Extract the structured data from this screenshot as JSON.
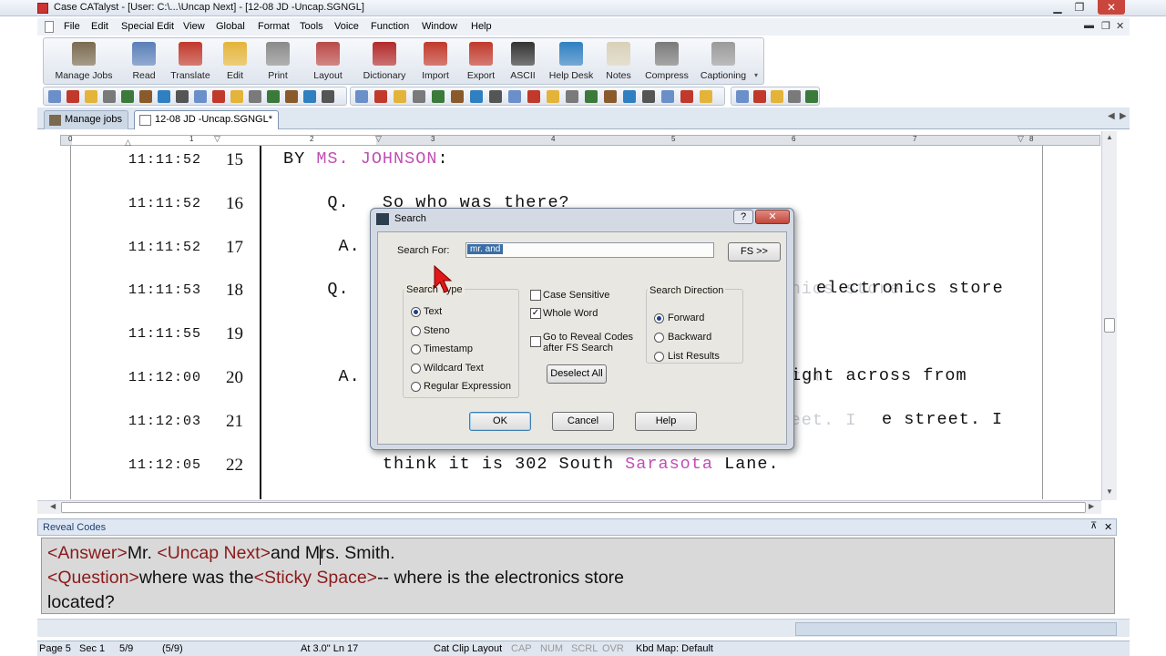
{
  "window": {
    "title": "Case CATalyst - [User: C:\\...\\Uncap Next] - [12-08 JD -Uncap.SGNGL]",
    "min": "▁",
    "max": "❐",
    "close": "✕",
    "mdi_min": "▬",
    "mdi_restore": "❐",
    "mdi_close": "✕"
  },
  "menu": [
    "File",
    "Edit",
    "Special Edit",
    "View",
    "Global",
    "Format",
    "Tools",
    "Voice",
    "Function",
    "Window",
    "Help"
  ],
  "toolbar": [
    {
      "label": "Manage Jobs",
      "color": "#7a6a50"
    },
    {
      "label": "Read",
      "color": "#5b7fb8"
    },
    {
      "label": "Translate",
      "color": "#c0392b"
    },
    {
      "label": "Edit",
      "color": "#e4b43a"
    },
    {
      "label": "Print",
      "color": "#8a8a8a"
    },
    {
      "label": "Layout",
      "color": "#b94a48"
    },
    {
      "label": "Dictionary",
      "color": "#b22b2b"
    },
    {
      "label": "Import",
      "color": "#c0392b"
    },
    {
      "label": "Export",
      "color": "#c0392b"
    },
    {
      "label": "ASCII",
      "color": "#333333"
    },
    {
      "label": "Help Desk",
      "color": "#2f7fc1"
    },
    {
      "label": "Notes",
      "color": "#d8d0b8"
    },
    {
      "label": "Compress",
      "color": "#7a7a7a"
    },
    {
      "label": "Captioning",
      "color": "#9a9a9a"
    }
  ],
  "tabs": [
    {
      "label": "Manage jobs",
      "active": false
    },
    {
      "label": "12-08 JD -Uncap.SGNGL*",
      "active": true
    }
  ],
  "ruler_numbers": [
    "0",
    "1",
    "2",
    "3",
    "4",
    "5",
    "6",
    "7",
    "8"
  ],
  "document": {
    "lines": [
      {
        "ts": "11:11:52",
        "num": "15",
        "pre": "BY ",
        "pink": "MS. JOHNSON",
        "post": ":",
        "faint": ""
      },
      {
        "ts": "11:11:52",
        "num": "16",
        "pre": "    Q.   So who was there?",
        "pink": "",
        "post": "",
        "faint": ""
      },
      {
        "ts": "11:11:52",
        "num": "17",
        "pre": "     A.",
        "pink": "",
        "post": "",
        "faint": "   Mr. and Mrs. Smith."
      },
      {
        "ts": "11:11:53",
        "num": "18",
        "pre": "    Q.",
        "pink": "",
        "post": "",
        "faint": "   Where was the -- where is the electronics store"
      },
      {
        "ts": "11:11:55",
        "num": "19",
        "pre": "",
        "pink": "",
        "post": "",
        "faint": "         located?"
      },
      {
        "ts": "11:12:00",
        "num": "20",
        "pre": "     A.",
        "pink": "",
        "post": "",
        "faint": "   Next door to my shop, right across from"
      },
      {
        "ts": "11:12:03",
        "num": "21",
        "pre": "",
        "pink": "",
        "post": "",
        "faint": "         the southeast corner of the cross street. I"
      },
      {
        "ts": "11:12:05",
        "num": "22",
        "pre": "         think it is 302 South ",
        "pink": "Sarasota",
        "post": " Lane.",
        "faint": ""
      }
    ],
    "right_visible": {
      "line18": "electronics store",
      "line20": "ight across from",
      "line21": "e street. I"
    }
  },
  "reveal": {
    "header": "Reveal Codes",
    "pin": "📌",
    "close": "✕",
    "line1": [
      {
        "t": "<Answer>",
        "c": true
      },
      {
        "t": "Mr. ",
        "c": false
      },
      {
        "t": "<Uncap Next>",
        "c": true
      },
      {
        "t": "and Mrs. Smith.",
        "c": false
      }
    ],
    "line2": [
      {
        "t": "<Question>",
        "c": true
      },
      {
        "t": "where was the",
        "c": false
      },
      {
        "t": "<Sticky Space>",
        "c": true
      },
      {
        "t": "-- where is the electronics store",
        "c": false
      }
    ],
    "line3": [
      {
        "t": "located?",
        "c": false
      }
    ]
  },
  "dialog": {
    "title": "Search",
    "help_q": "?",
    "close": "✕",
    "search_for_label": "Search For:",
    "search_for_value": "mr. and",
    "fs_button": "FS >>",
    "search_type_label": "Search Type",
    "search_types": [
      {
        "label": "Text",
        "selected": true
      },
      {
        "label": "Steno",
        "selected": false
      },
      {
        "label": "Timestamp",
        "selected": false
      },
      {
        "label": "Wildcard Text",
        "selected": false
      },
      {
        "label": "Regular Expression",
        "selected": false
      }
    ],
    "case_sensitive": "Case Sensitive",
    "whole_word": "Whole Word",
    "reveal_codes_1": "Go to Reveal Codes",
    "reveal_codes_2": "after FS Search",
    "deselect_all": "Deselect All",
    "direction_label": "Search Direction",
    "directions": [
      {
        "label": "Forward",
        "selected": true
      },
      {
        "label": "Backward",
        "selected": false
      },
      {
        "label": "List Results",
        "selected": false
      }
    ],
    "ok": "OK",
    "cancel": "Cancel",
    "help": "Help"
  },
  "status": {
    "page": "Page 5",
    "sec": "Sec 1",
    "pages": "5/9",
    "pages2": "(5/9)",
    "at": "At 3.0\"  Ln 17",
    "layout": "Cat Clip Layout",
    "cap": "CAP",
    "num": "NUM",
    "scrl": "SCRL",
    "ovr": "OVR",
    "kbd": "Kbd Map: Default"
  }
}
